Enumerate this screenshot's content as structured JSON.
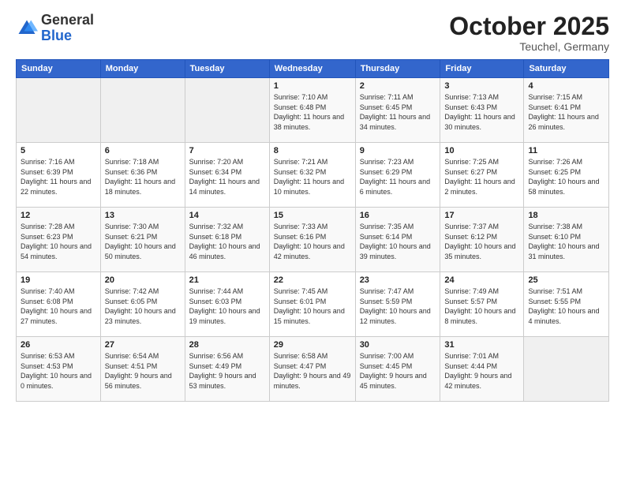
{
  "header": {
    "logo_general": "General",
    "logo_blue": "Blue",
    "month_title": "October 2025",
    "location": "Teuchel, Germany"
  },
  "days_of_week": [
    "Sunday",
    "Monday",
    "Tuesday",
    "Wednesday",
    "Thursday",
    "Friday",
    "Saturday"
  ],
  "weeks": [
    [
      {
        "day": "",
        "sunrise": "",
        "sunset": "",
        "daylight": ""
      },
      {
        "day": "",
        "sunrise": "",
        "sunset": "",
        "daylight": ""
      },
      {
        "day": "",
        "sunrise": "",
        "sunset": "",
        "daylight": ""
      },
      {
        "day": "1",
        "sunrise": "Sunrise: 7:10 AM",
        "sunset": "Sunset: 6:48 PM",
        "daylight": "Daylight: 11 hours and 38 minutes."
      },
      {
        "day": "2",
        "sunrise": "Sunrise: 7:11 AM",
        "sunset": "Sunset: 6:45 PM",
        "daylight": "Daylight: 11 hours and 34 minutes."
      },
      {
        "day": "3",
        "sunrise": "Sunrise: 7:13 AM",
        "sunset": "Sunset: 6:43 PM",
        "daylight": "Daylight: 11 hours and 30 minutes."
      },
      {
        "day": "4",
        "sunrise": "Sunrise: 7:15 AM",
        "sunset": "Sunset: 6:41 PM",
        "daylight": "Daylight: 11 hours and 26 minutes."
      }
    ],
    [
      {
        "day": "5",
        "sunrise": "Sunrise: 7:16 AM",
        "sunset": "Sunset: 6:39 PM",
        "daylight": "Daylight: 11 hours and 22 minutes."
      },
      {
        "day": "6",
        "sunrise": "Sunrise: 7:18 AM",
        "sunset": "Sunset: 6:36 PM",
        "daylight": "Daylight: 11 hours and 18 minutes."
      },
      {
        "day": "7",
        "sunrise": "Sunrise: 7:20 AM",
        "sunset": "Sunset: 6:34 PM",
        "daylight": "Daylight: 11 hours and 14 minutes."
      },
      {
        "day": "8",
        "sunrise": "Sunrise: 7:21 AM",
        "sunset": "Sunset: 6:32 PM",
        "daylight": "Daylight: 11 hours and 10 minutes."
      },
      {
        "day": "9",
        "sunrise": "Sunrise: 7:23 AM",
        "sunset": "Sunset: 6:29 PM",
        "daylight": "Daylight: 11 hours and 6 minutes."
      },
      {
        "day": "10",
        "sunrise": "Sunrise: 7:25 AM",
        "sunset": "Sunset: 6:27 PM",
        "daylight": "Daylight: 11 hours and 2 minutes."
      },
      {
        "day": "11",
        "sunrise": "Sunrise: 7:26 AM",
        "sunset": "Sunset: 6:25 PM",
        "daylight": "Daylight: 10 hours and 58 minutes."
      }
    ],
    [
      {
        "day": "12",
        "sunrise": "Sunrise: 7:28 AM",
        "sunset": "Sunset: 6:23 PM",
        "daylight": "Daylight: 10 hours and 54 minutes."
      },
      {
        "day": "13",
        "sunrise": "Sunrise: 7:30 AM",
        "sunset": "Sunset: 6:21 PM",
        "daylight": "Daylight: 10 hours and 50 minutes."
      },
      {
        "day": "14",
        "sunrise": "Sunrise: 7:32 AM",
        "sunset": "Sunset: 6:18 PM",
        "daylight": "Daylight: 10 hours and 46 minutes."
      },
      {
        "day": "15",
        "sunrise": "Sunrise: 7:33 AM",
        "sunset": "Sunset: 6:16 PM",
        "daylight": "Daylight: 10 hours and 42 minutes."
      },
      {
        "day": "16",
        "sunrise": "Sunrise: 7:35 AM",
        "sunset": "Sunset: 6:14 PM",
        "daylight": "Daylight: 10 hours and 39 minutes."
      },
      {
        "day": "17",
        "sunrise": "Sunrise: 7:37 AM",
        "sunset": "Sunset: 6:12 PM",
        "daylight": "Daylight: 10 hours and 35 minutes."
      },
      {
        "day": "18",
        "sunrise": "Sunrise: 7:38 AM",
        "sunset": "Sunset: 6:10 PM",
        "daylight": "Daylight: 10 hours and 31 minutes."
      }
    ],
    [
      {
        "day": "19",
        "sunrise": "Sunrise: 7:40 AM",
        "sunset": "Sunset: 6:08 PM",
        "daylight": "Daylight: 10 hours and 27 minutes."
      },
      {
        "day": "20",
        "sunrise": "Sunrise: 7:42 AM",
        "sunset": "Sunset: 6:05 PM",
        "daylight": "Daylight: 10 hours and 23 minutes."
      },
      {
        "day": "21",
        "sunrise": "Sunrise: 7:44 AM",
        "sunset": "Sunset: 6:03 PM",
        "daylight": "Daylight: 10 hours and 19 minutes."
      },
      {
        "day": "22",
        "sunrise": "Sunrise: 7:45 AM",
        "sunset": "Sunset: 6:01 PM",
        "daylight": "Daylight: 10 hours and 15 minutes."
      },
      {
        "day": "23",
        "sunrise": "Sunrise: 7:47 AM",
        "sunset": "Sunset: 5:59 PM",
        "daylight": "Daylight: 10 hours and 12 minutes."
      },
      {
        "day": "24",
        "sunrise": "Sunrise: 7:49 AM",
        "sunset": "Sunset: 5:57 PM",
        "daylight": "Daylight: 10 hours and 8 minutes."
      },
      {
        "day": "25",
        "sunrise": "Sunrise: 7:51 AM",
        "sunset": "Sunset: 5:55 PM",
        "daylight": "Daylight: 10 hours and 4 minutes."
      }
    ],
    [
      {
        "day": "26",
        "sunrise": "Sunrise: 6:53 AM",
        "sunset": "Sunset: 4:53 PM",
        "daylight": "Daylight: 10 hours and 0 minutes."
      },
      {
        "day": "27",
        "sunrise": "Sunrise: 6:54 AM",
        "sunset": "Sunset: 4:51 PM",
        "daylight": "Daylight: 9 hours and 56 minutes."
      },
      {
        "day": "28",
        "sunrise": "Sunrise: 6:56 AM",
        "sunset": "Sunset: 4:49 PM",
        "daylight": "Daylight: 9 hours and 53 minutes."
      },
      {
        "day": "29",
        "sunrise": "Sunrise: 6:58 AM",
        "sunset": "Sunset: 4:47 PM",
        "daylight": "Daylight: 9 hours and 49 minutes."
      },
      {
        "day": "30",
        "sunrise": "Sunrise: 7:00 AM",
        "sunset": "Sunset: 4:45 PM",
        "daylight": "Daylight: 9 hours and 45 minutes."
      },
      {
        "day": "31",
        "sunrise": "Sunrise: 7:01 AM",
        "sunset": "Sunset: 4:44 PM",
        "daylight": "Daylight: 9 hours and 42 minutes."
      },
      {
        "day": "",
        "sunrise": "",
        "sunset": "",
        "daylight": ""
      }
    ]
  ]
}
